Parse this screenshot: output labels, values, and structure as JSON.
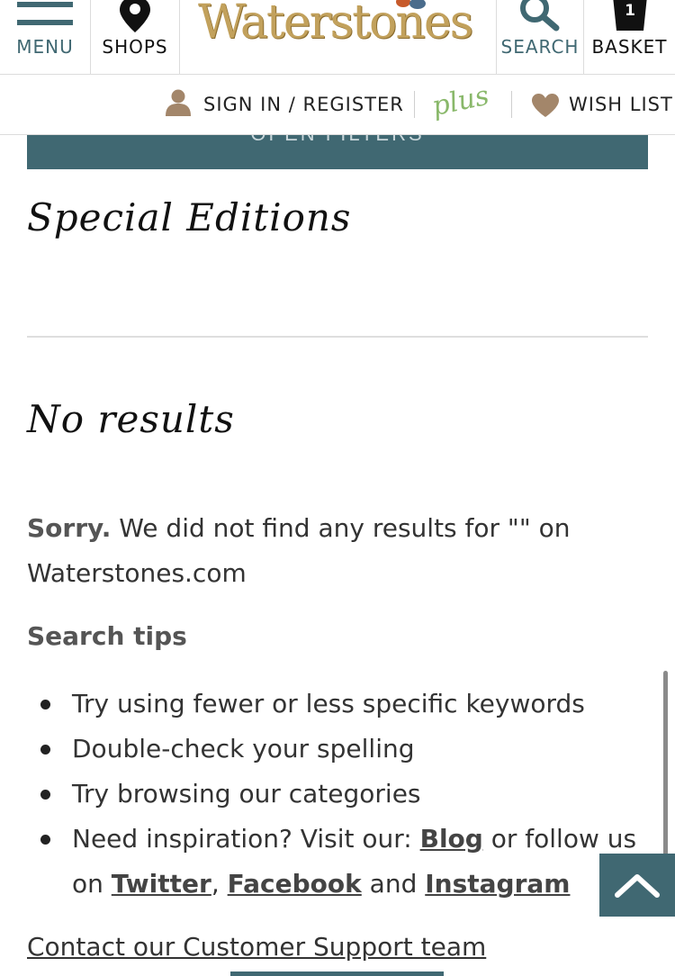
{
  "header": {
    "menu_label": "MENU",
    "shops_label": "SHOPS",
    "logo_text": "Waterstones",
    "search_label": "SEARCH",
    "basket_label": "BASKET",
    "basket_count": "1"
  },
  "subheader": {
    "sign_in_label": "SIGN IN / REGISTER",
    "plus_label": "plus",
    "wish_list_label": "WISH LIST"
  },
  "filters": {
    "button_label": "OPEN FILTERS"
  },
  "category": {
    "title": "Special Editions"
  },
  "results": {
    "title": "No results",
    "sorry_label": "Sorry.",
    "sorry_text": " We did not find any results for \"\" on Waterstones.com"
  },
  "search_tips": {
    "heading": "Search tips",
    "tip_1": "Try using fewer or less specific keywords",
    "tip_2": "Double-check your spelling",
    "tip_3": "Try browsing our categories",
    "tip_4_prefix": "Need inspiration? Visit our: ",
    "blog_link": "Blog",
    "tip_4_mid": " or follow us on ",
    "twitter_link": "Twitter",
    "comma": ", ",
    "facebook_link": "Facebook",
    "and_text": " and ",
    "instagram_link": "Instagram"
  },
  "support": {
    "link_label": "Contact our Customer Support team"
  },
  "colors": {
    "brand_teal": "#406872",
    "logo_gold": "#c2a15c",
    "accent_brown": "#a3866a",
    "plus_green": "#89b86a"
  }
}
